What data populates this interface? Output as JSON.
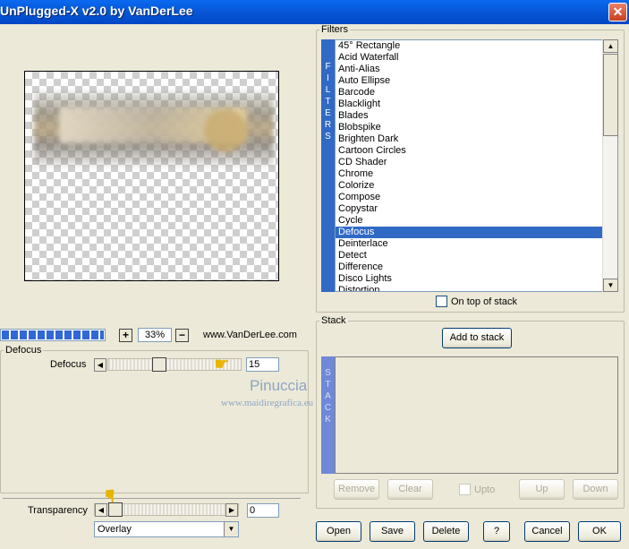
{
  "window": {
    "title": "UnPlugged-X v2.0 by VanDerLee",
    "close_label": "✕"
  },
  "preview": {
    "zoom": "33%",
    "zoom_plus": "+",
    "zoom_minus": "−",
    "website": "www.VanDerLee.com",
    "progress_fraction": 0.98
  },
  "defocus": {
    "group_label": "Defocus",
    "param_label": "Defocus",
    "value": "15",
    "slider_fraction": 0.33
  },
  "watermark": {
    "name": "Pinuccia",
    "url": "www.maidiregrafica.eu"
  },
  "transparency": {
    "label": "Transparency",
    "value": "0",
    "slider_fraction": 0.0
  },
  "blend": {
    "selected": "Overlay"
  },
  "filters": {
    "group_label": "Filters",
    "sidebar_label": "FILTERS",
    "items": [
      "45° Rectangle",
      "Acid Waterfall",
      "Anti-Alias",
      "Auto Ellipse",
      "Barcode",
      "Blacklight",
      "Blades",
      "Blobspike",
      "Brighten Dark",
      "Cartoon Circles",
      "CD Shader",
      "Chrome",
      "Colorize",
      "Compose",
      "Copystar",
      "Cycle",
      "Defocus",
      "Deinterlace",
      "Detect",
      "Difference",
      "Disco Lights",
      "Distortion"
    ],
    "selected_index": 16,
    "on_top_label": "On top of stack"
  },
  "stack": {
    "group_label": "Stack",
    "add_label": "Add to stack",
    "sidebar_label": "STACK",
    "remove_label": "Remove",
    "clear_label": "Clear",
    "upto_label": "Upto",
    "up_label": "Up",
    "down_label": "Down"
  },
  "footer": {
    "open": "Open",
    "save": "Save",
    "delete": "Delete",
    "help": "?",
    "cancel": "Cancel",
    "ok": "OK"
  },
  "colors": {
    "titlebar": "#0758d8",
    "selection": "#316ac5",
    "face": "#ece9d8"
  },
  "icons": [
    "close-icon",
    "pointing-hand-icon",
    "scroll-up-arrow-icon",
    "scroll-down-arrow-icon",
    "dropdown-arrow-icon"
  ]
}
